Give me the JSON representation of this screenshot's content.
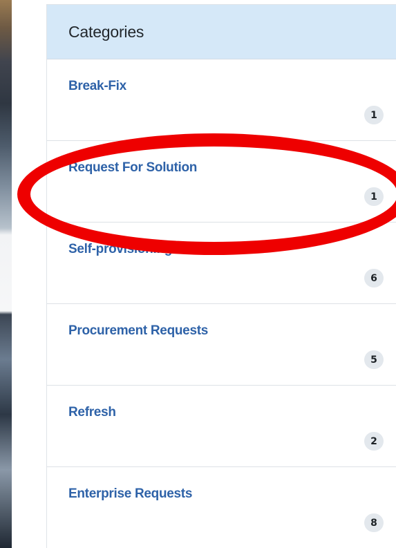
{
  "categories_panel": {
    "title": "Categories",
    "items": [
      {
        "label": "Break-Fix",
        "count": "1"
      },
      {
        "label": "Request For Solution",
        "count": "1"
      },
      {
        "label": "Self-provisioning",
        "count": "6"
      },
      {
        "label": "Procurement Requests",
        "count": "5"
      },
      {
        "label": "Refresh",
        "count": "2"
      },
      {
        "label": "Enterprise Requests",
        "count": "8"
      }
    ]
  },
  "annotation": {
    "shape": "ellipse",
    "color": "#ee0000",
    "target": "Request For Solution"
  },
  "colors": {
    "header_bg": "#d5e8f8",
    "link": "#2e62a8",
    "badge_bg": "#e3e8ed"
  }
}
